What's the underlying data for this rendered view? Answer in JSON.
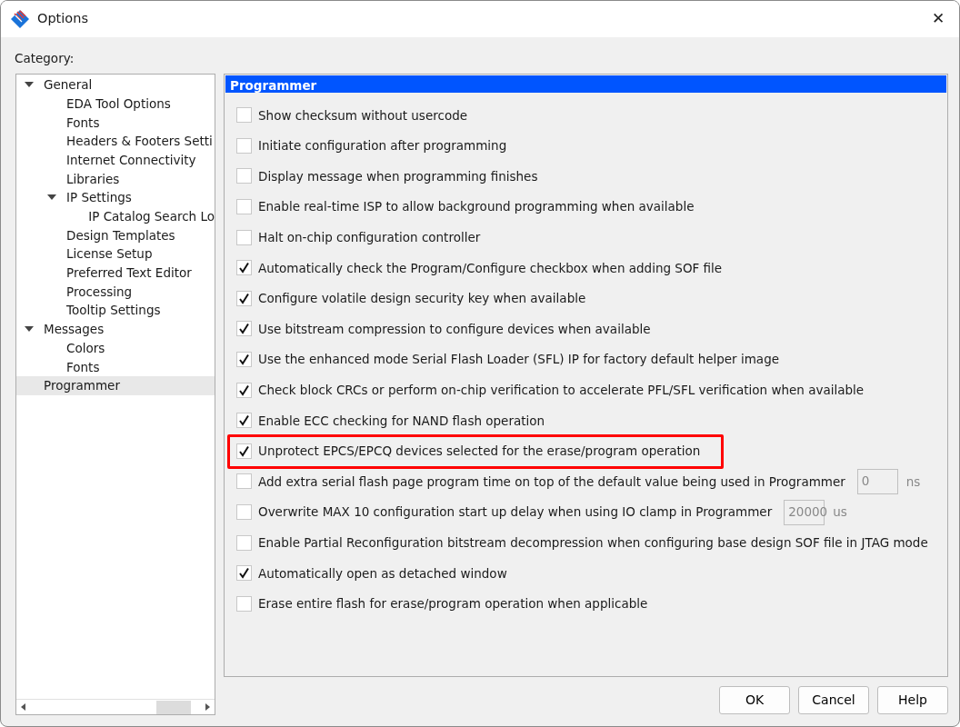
{
  "window": {
    "title": "Options",
    "close": "✕"
  },
  "category_label": "Category:",
  "tree": [
    {
      "label": "General",
      "expanded": true,
      "selected": false,
      "children": [
        {
          "label": "EDA Tool Options",
          "selected": false
        },
        {
          "label": "Fonts",
          "selected": false
        },
        {
          "label": "Headers & Footers Setti",
          "selected": false
        },
        {
          "label": "Internet Connectivity",
          "selected": false
        },
        {
          "label": "Libraries",
          "selected": false
        },
        {
          "label": "IP Settings",
          "expanded": true,
          "selected": false,
          "children": [
            {
              "label": "IP Catalog Search Lo",
              "selected": false
            }
          ]
        },
        {
          "label": "Design Templates",
          "selected": false
        },
        {
          "label": "License Setup",
          "selected": false
        },
        {
          "label": "Preferred Text Editor",
          "selected": false
        },
        {
          "label": "Processing",
          "selected": false
        },
        {
          "label": "Tooltip Settings",
          "selected": false
        }
      ]
    },
    {
      "label": "Messages",
      "expanded": true,
      "selected": false,
      "children": [
        {
          "label": "Colors",
          "selected": false
        },
        {
          "label": "Fonts",
          "selected": false
        }
      ]
    },
    {
      "label": "Programmer",
      "selected": true
    }
  ],
  "panel": {
    "title": "Programmer",
    "options": [
      {
        "kind": "checkbox",
        "label": "Show checksum without usercode",
        "checked": false,
        "highlighted": false
      },
      {
        "kind": "checkbox",
        "label": "Initiate configuration after programming",
        "checked": false,
        "highlighted": false
      },
      {
        "kind": "checkbox",
        "label": "Display message when programming finishes",
        "checked": false,
        "highlighted": false
      },
      {
        "kind": "checkbox",
        "label": "Enable real-time ISP to allow background programming when available",
        "checked": false,
        "highlighted": false
      },
      {
        "kind": "checkbox",
        "label": "Halt on-chip configuration controller",
        "checked": false,
        "highlighted": false
      },
      {
        "kind": "checkbox",
        "label": "Automatically check the Program/Configure checkbox when adding SOF file",
        "checked": true,
        "highlighted": false
      },
      {
        "kind": "checkbox",
        "label": "Configure volatile design security key when available",
        "checked": true,
        "highlighted": false
      },
      {
        "kind": "checkbox",
        "label": "Use bitstream compression to configure devices when available",
        "checked": true,
        "highlighted": false
      },
      {
        "kind": "checkbox",
        "label": "Use the enhanced mode Serial Flash Loader (SFL) IP for factory default helper image",
        "checked": true,
        "highlighted": false
      },
      {
        "kind": "checkbox",
        "label": "Check block CRCs or perform on-chip verification to accelerate PFL/SFL verification when available",
        "checked": true,
        "highlighted": false
      },
      {
        "kind": "checkbox",
        "label": "Enable ECC checking for NAND flash operation",
        "checked": true,
        "highlighted": false
      },
      {
        "kind": "checkbox",
        "label": "Unprotect EPCS/EPCQ devices selected for the erase/program operation",
        "checked": true,
        "highlighted": true
      },
      {
        "kind": "checkbox_with_value",
        "label": "Add extra serial flash page program time on top of the default value being used in Programmer",
        "checked": false,
        "highlighted": false,
        "value": "0",
        "unit": "ns"
      },
      {
        "kind": "checkbox_with_value",
        "label": "Overwrite MAX 10 configuration start up delay when using IO clamp in Programmer",
        "checked": false,
        "highlighted": false,
        "value": "20000",
        "unit": "us"
      },
      {
        "kind": "checkbox",
        "label": "Enable Partial Reconfiguration bitstream decompression when configuring base design SOF file in JTAG mode",
        "checked": false,
        "highlighted": false
      },
      {
        "kind": "checkbox",
        "label": "Automatically open as detached window",
        "checked": true,
        "highlighted": false
      },
      {
        "kind": "checkbox",
        "label": "Erase entire flash for erase/program operation when applicable",
        "checked": false,
        "highlighted": false
      }
    ]
  },
  "buttons": [
    "OK",
    "Cancel",
    "Help"
  ]
}
